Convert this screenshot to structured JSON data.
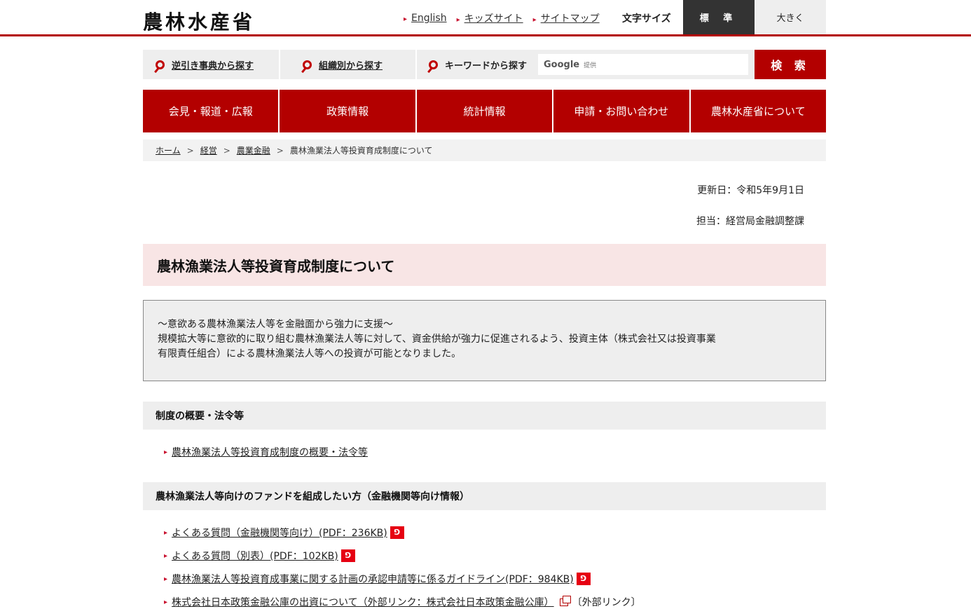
{
  "header": {
    "logo": "農林水産省",
    "links": [
      "English",
      "キッズサイト",
      "サイトマップ"
    ],
    "fontsize_label": "文字サイズ",
    "fontsize_standard": "標 準",
    "fontsize_large": "大きく"
  },
  "search": {
    "reverse_lookup": "逆引き事典から探す",
    "by_org": "組織別から探す",
    "by_keyword": "キーワードから探す",
    "google": "Google",
    "provided": "提供",
    "button": "検 索"
  },
  "nav": [
    "会見・報道・広報",
    "政策情報",
    "統計情報",
    "申請・お問い合わせ",
    "農林水産省について"
  ],
  "breadcrumb": [
    "ホーム",
    "経営",
    "農業金融",
    "農林漁業法人等投資育成制度について"
  ],
  "updated": "更新日：令和5年9月1日",
  "contact": "担当：経営局金融調整課",
  "title": "農林漁業法人等投資育成制度について",
  "intro": {
    "line1": "～意欲ある農林漁業法人等を金融面から強力に支援～",
    "line2": "規模拡大等に意欲的に取り組む農林漁業法人等に対して、資金供給が強力に促進されるよう、投資主体（株式会社又は投資事業",
    "line3": "有限責任組合）による農林漁業法人等への投資が可能となりました。"
  },
  "section1": {
    "heading": "制度の概要・法令等",
    "items": [
      "農林漁業法人等投資育成制度の概要・法令等"
    ]
  },
  "section2": {
    "heading": "農林漁業法人等向けのファンドを組成したい方（金融機関等向け情報）",
    "items": [
      "よくある質問（金融機関等向け）(PDF：236KB)",
      "よくある質問（別表）(PDF：102KB)",
      "農林漁業法人等投資育成事業に関する計画の承認申請等に係るガイドライン(PDF：984KB)",
      "株式会社日本政策金融公庫の出資について（外部リンク：株式会社日本政策金融公庫）"
    ],
    "external_label": "〔外部リンク〕"
  },
  "colors": {
    "brand_red": "#b30000",
    "pdf_red": "#e60012"
  }
}
